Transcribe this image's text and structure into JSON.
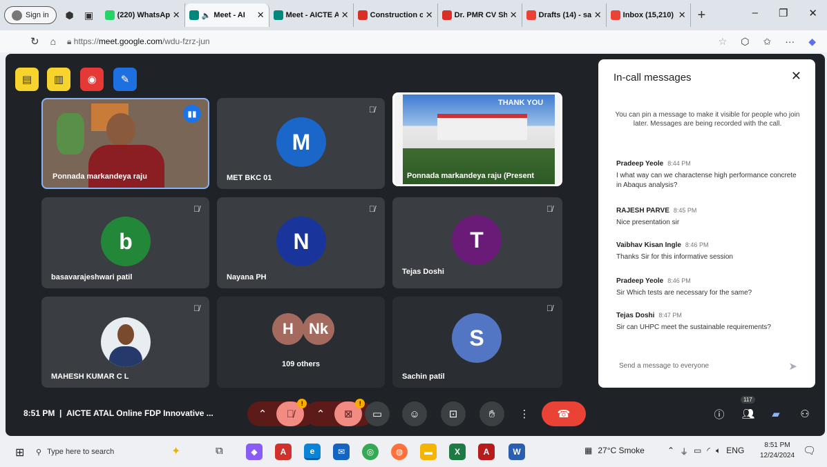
{
  "browser": {
    "signin_label": "Sign in",
    "tabs": [
      {
        "title": "(220) WhatsAp",
        "color": "#25d366"
      },
      {
        "title": "Meet - AI",
        "color": "#00897b"
      },
      {
        "title": "Meet - AICTE A",
        "color": "#00897b"
      },
      {
        "title": "Construction c",
        "color": "#d93025"
      },
      {
        "title": "Dr. PMR CV Sh",
        "color": "#d93025"
      },
      {
        "title": "Drafts (14) - sa",
        "color": "#ea4335"
      },
      {
        "title": "Inbox (15,210)",
        "color": "#ea4335"
      }
    ],
    "url_prefix": "https://",
    "url_host": "meet.google.com",
    "url_path": "/wdu-fzrz-jun"
  },
  "tiles": [
    {
      "name": "Ponnada markandeya raju"
    },
    {
      "name": "MET BKC 01",
      "initial": "M",
      "color": "#1a66c9"
    },
    {
      "name": "Ponnada markandeya raju (Present",
      "banner": "THANK YOU"
    },
    {
      "name": "basavarajeshwari patil",
      "initial": "b",
      "color": "#23873a"
    },
    {
      "name": "Nayana PH",
      "initial": "N",
      "color": "#19349a"
    },
    {
      "name": "Tejas Doshi",
      "initial": "T",
      "color": "#6a1b78"
    },
    {
      "name": "MAHESH KUMAR C L"
    },
    {
      "name": "109 others",
      "initials": [
        "H",
        "Nk"
      ]
    },
    {
      "name": "Sachin patil",
      "initial": "S",
      "color": "#5275c4"
    }
  ],
  "panel": {
    "title": "In-call messages",
    "info": "You can pin a message to make it visible for people who join later. Messages are being recorded with the call.",
    "messages": [
      {
        "sender": "Pradeep Yeole",
        "time": "8:44 PM",
        "text": "I what way can we charactense high performance concrete in Abaqus analysis?"
      },
      {
        "sender": "RAJESH PARVE",
        "time": "8:45 PM",
        "text": "Nice presentation sir"
      },
      {
        "sender": "Vaibhav Kisan Ingle",
        "time": "8:46 PM",
        "text": "Thanks Sir for this informative session"
      },
      {
        "sender": "Pradeep Yeole",
        "time": "8:46 PM",
        "text": "Sir Which tests are necessary for the same?"
      },
      {
        "sender": "Tejas Doshi",
        "time": "8:47 PM",
        "text": "Sir can UHPC meet the sustainable requirements?"
      }
    ],
    "send_placeholder": "Send a message to everyone"
  },
  "bottom": {
    "time": "8:51 PM",
    "meeting_title": "AICTE ATAL Online FDP Innovative ...",
    "participants_count": "117"
  },
  "taskbar": {
    "search_placeholder": "Type here to search",
    "weather": "27°C  Smoke",
    "language": "ENG",
    "clock_time": "8:51 PM",
    "clock_date": "12/24/2024"
  }
}
